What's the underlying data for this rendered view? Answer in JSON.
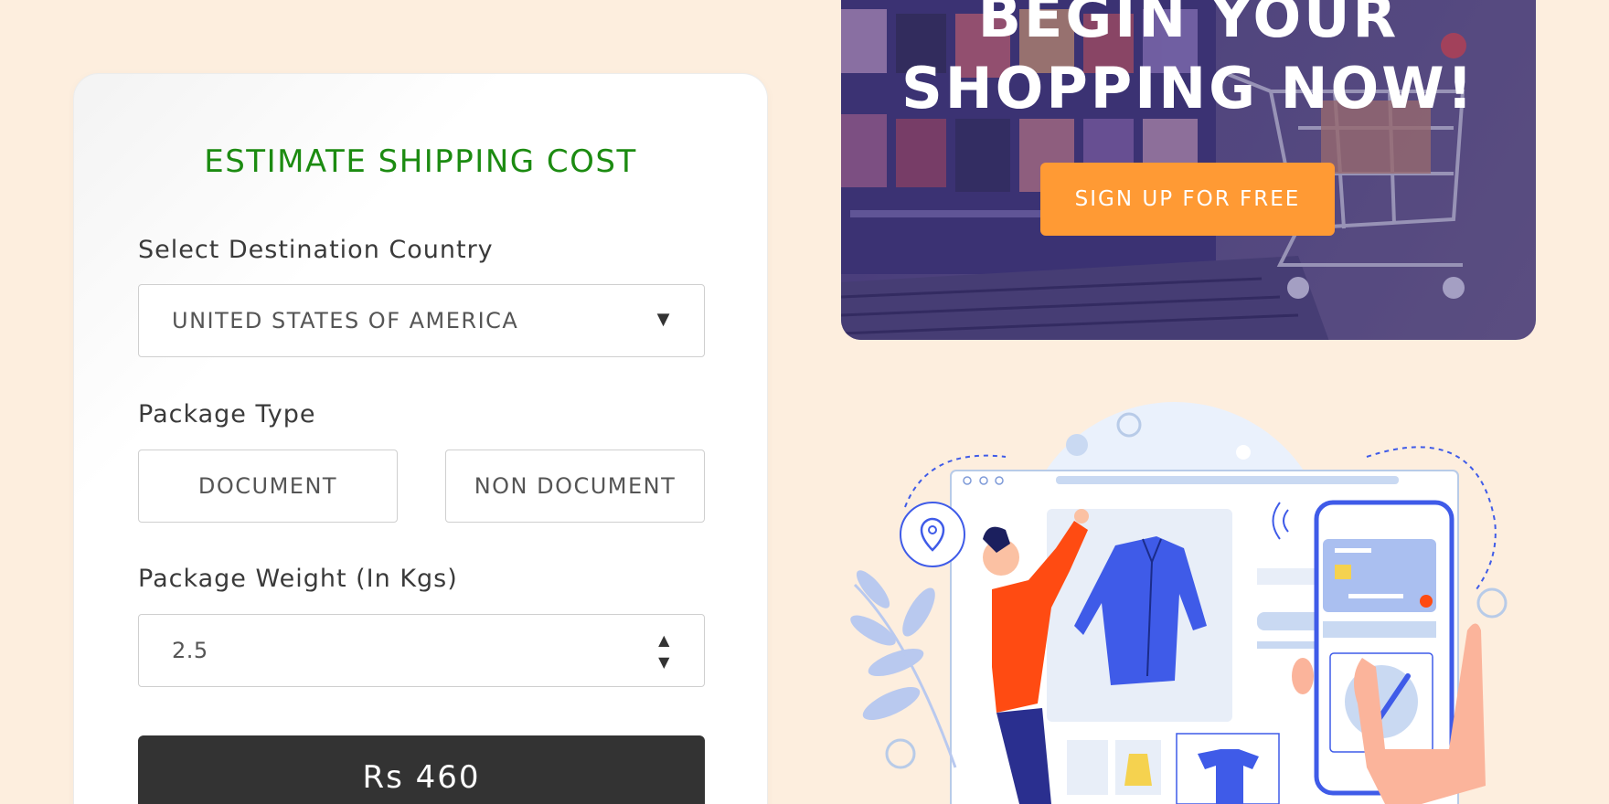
{
  "form": {
    "title": "ESTIMATE SHIPPING COST",
    "country_label": "Select Destination Country",
    "country_value": "UNITED STATES OF AMERICA",
    "package_type_label": "Package Type",
    "package_types": [
      "DOCUMENT",
      "NON DOCUMENT"
    ],
    "weight_label": "Package Weight (In Kgs)",
    "weight_value": "2.5",
    "price": "Rs 460"
  },
  "banner": {
    "title_line1": "BEGIN YOUR",
    "title_line2": "SHOPPING NOW!",
    "cta": "SIGN UP FOR FREE"
  },
  "icons": {
    "dropdown": "chevron-down-icon",
    "stepper_up": "caret-up-icon",
    "stepper_down": "caret-down-icon",
    "location": "map-pin-icon",
    "wifi": "signal-icon",
    "check": "checkmark-icon"
  },
  "colors": {
    "page_bg": "#fdeede",
    "title_green": "#1c8b11",
    "price_button": "#333333",
    "cta_orange": "#ff9a34",
    "accent_blue": "#3f5be8",
    "shirt_orange": "#ff4b12"
  }
}
